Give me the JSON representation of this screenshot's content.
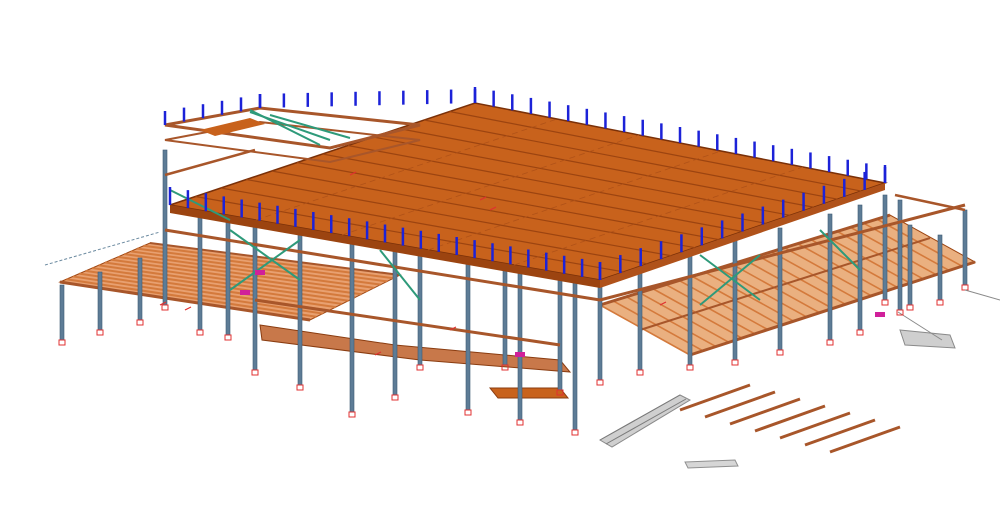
{
  "colors": {
    "background": "#ffffff",
    "roof_deck": "#c8621c",
    "roof_deck_dark": "#9c4410",
    "beam": "#a8562a",
    "beam_light": "#d47a3c",
    "column": "#5d7c96",
    "column_dark": "#3e5a73",
    "bracing": "#2e9a7a",
    "stub_post": "#1c22d8",
    "base_marker": "#e03030",
    "accent": "#d0209a",
    "stair": "#9a9a9a"
  },
  "icons": {
    "roof_post": "blue-stub-post-icon",
    "column_base": "red-base-plate-icon"
  }
}
